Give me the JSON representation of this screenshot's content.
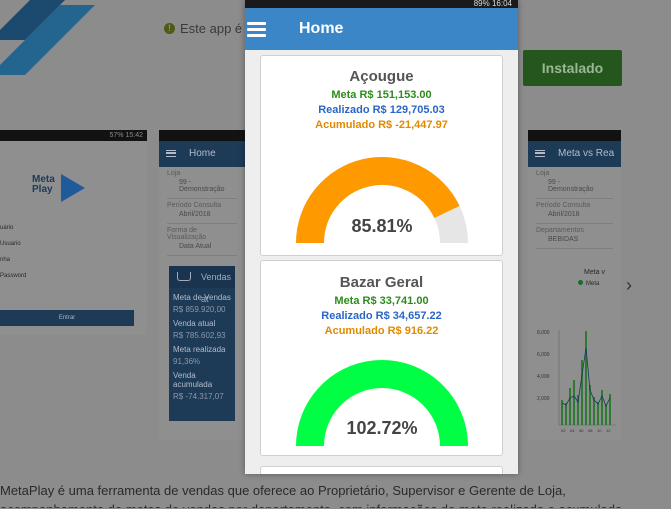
{
  "background": {
    "notice_text": "Este app é",
    "install_button": "Instalado",
    "thumb1": {
      "status": "57% 15:42",
      "logo_text_1": "Meta",
      "logo_text_2": "Play",
      "lines": [
        "uário",
        "Usuario",
        "nha",
        "Password"
      ],
      "enter_button": "Entrar"
    },
    "thumb2": {
      "title": "Home",
      "fields": [
        {
          "label": "Loja",
          "value": "99 - Demonstração"
        },
        {
          "label": "Período Consulta",
          "value": "Abril/2018"
        },
        {
          "label": "Forma de Visualização",
          "value": "Data Atual"
        }
      ],
      "dashboard_title": "Vendas at",
      "kv": [
        {
          "k": "Meta de Vendas",
          "v": "R$ 859.920,00"
        },
        {
          "k": "Venda atual",
          "v": "R$ 785.602,93"
        },
        {
          "k": "Meta realizada",
          "v": "91,36%"
        },
        {
          "k": "Venda acumulada",
          "v": "R$ -74.317,07"
        }
      ]
    },
    "thumb3": {
      "title": "Meta vs Rea",
      "fields": [
        {
          "label": "Loja",
          "value": "99 - Demonstração"
        },
        {
          "label": "Período Consulta",
          "value": "Abril/2018"
        },
        {
          "label": "Departamentos",
          "value": "BEBIDAS"
        }
      ],
      "chart_title": "Meta v",
      "legend": "Meta",
      "y_ticks": [
        "8,000",
        "6,000",
        "4,000",
        "2,000"
      ],
      "x_ticks": [
        "02",
        "04",
        "06",
        "08",
        "10",
        "12"
      ]
    },
    "description": "MetaPlay é uma ferramenta de vendas que oferece ao Proprietário, Supervisor e Gerente de Loja,",
    "description_line2": "acompanhamento de metas de vendas por departamento, com informações de meta realizada e acumulada."
  },
  "phone": {
    "status": "89% 16:04",
    "app_title": "Home",
    "cards": [
      {
        "title": "Açougue",
        "meta": "Meta R$ 151,153.00",
        "realizado": "Realizado R$ 129,705.03",
        "acumulado": "Acumulado R$ -21,447.97",
        "percent_label": "85.81%",
        "percent_value": 85.81,
        "color": "#ff9900"
      },
      {
        "title": "Bazar Geral",
        "meta": "Meta R$ 33,741.00",
        "realizado": "Realizado R$ 34,657.22",
        "acumulado": "Acumulado R$ 916.22",
        "percent_label": "102.72%",
        "percent_value": 102.72,
        "color": "#00ff44"
      }
    ]
  },
  "colors": {
    "app_bar": "#3a86c6",
    "meta": "#2e8b1e",
    "realizado": "#2a66c8",
    "acumulado": "#e08a00",
    "gauge_track": "#e6e6e6"
  }
}
